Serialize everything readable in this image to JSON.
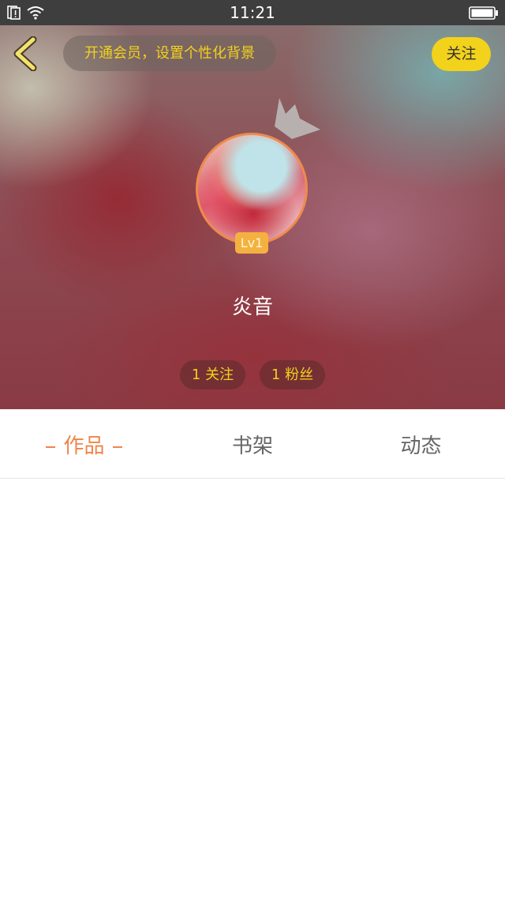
{
  "status_bar": {
    "time": "11:21",
    "icons": [
      "sim-alert-icon",
      "wifi-icon",
      "battery-icon"
    ]
  },
  "header": {
    "back_icon": "chevron-left-icon",
    "vip_banner_text": "开通会员，设置个性化背景",
    "follow_button_label": "关注"
  },
  "profile": {
    "crown_icon": "crown-icon",
    "level_badge": "Lv1",
    "username": "炎音",
    "following_label": "1 关注",
    "fans_label": "1 粉丝"
  },
  "tabs": [
    {
      "label": "作品",
      "active": true
    },
    {
      "label": "书架",
      "active": false
    },
    {
      "label": "动态",
      "active": false
    }
  ],
  "colors": {
    "accent_yellow": "#f2d21b",
    "active_tab_orange": "#f0844a",
    "level_badge": "#f4b13f"
  }
}
